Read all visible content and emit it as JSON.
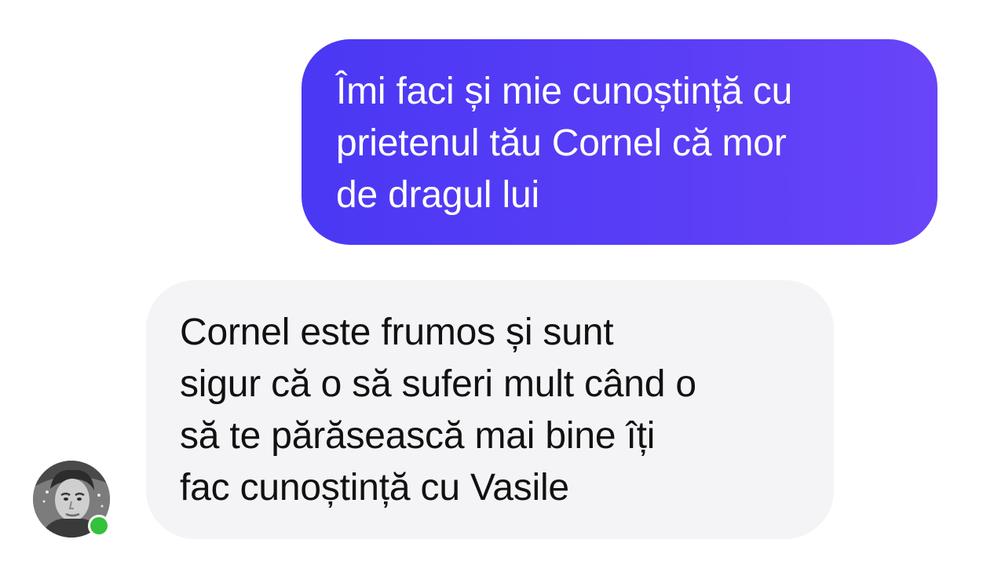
{
  "conversation": {
    "outgoing_message": {
      "lines": [
        "Îmi faci și mie cunoștință cu",
        "prietenul tău Cornel că mor",
        "de dragul lui"
      ]
    },
    "incoming_message": {
      "lines": [
        "Cornel este frumos și sunt",
        "sigur că o să suferi mult când o",
        "să te părăsească mai bine îți",
        "fac cunoștință cu Vasile"
      ]
    },
    "sender": {
      "avatar": "person-photo",
      "status_icon": "online-status-dot",
      "online": true
    }
  },
  "colors": {
    "outgoing_bubble": "#5a3ef6",
    "incoming_bubble": "#f4f4f6",
    "online": "#34c13c"
  }
}
